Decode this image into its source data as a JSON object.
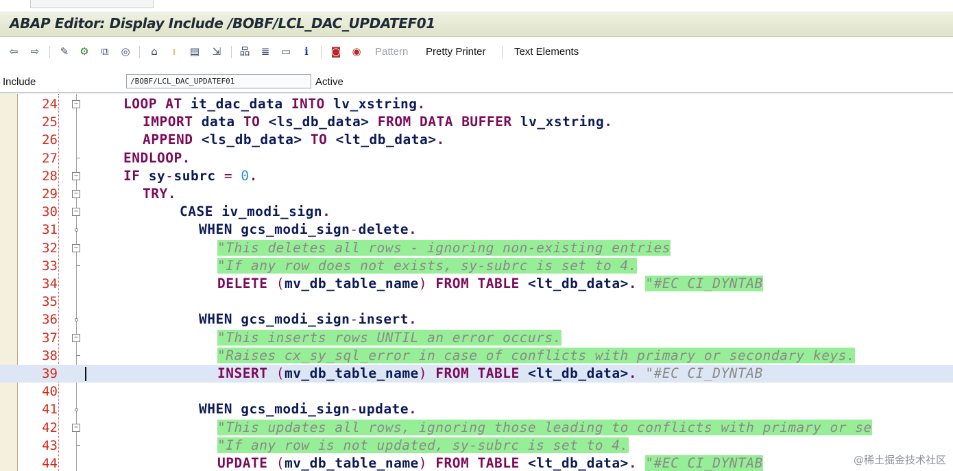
{
  "window": {
    "title": "ABAP Editor: Display Include /BOBF/LCL_DAC_UPDATEF01"
  },
  "toolbar": {
    "icons": [
      "back-arrow-icon",
      "forward-arrow-icon",
      "other-object-icon",
      "display-change-icon",
      "activate-icon",
      "where-used-icon",
      "object-list-icon",
      "navigation-window-icon",
      "set-breakpoint-icon",
      "insert-statement-icon",
      "object-hierarchy-icon",
      "display-structure-icon",
      "fullscreen-icon",
      "info-icon",
      "enhance-icon",
      "debug-icon"
    ],
    "pattern_label": "Pattern",
    "pretty_printer_label": "Pretty Printer",
    "text_elements_label": "Text Elements"
  },
  "include_field": {
    "label": "Include",
    "value": "/BOBF/LCL_DAC_UPDATEF01",
    "status": "Active"
  },
  "editor": {
    "line_numbers": [
      "24",
      "25",
      "26",
      "27",
      "28",
      "29",
      "30",
      "31",
      "32",
      "33",
      "34",
      "35",
      "36",
      "37",
      "38",
      "39",
      "40",
      "41",
      "42",
      "43",
      "44"
    ],
    "current_line": "39"
  },
  "code": {
    "l24": [
      "LOOP AT",
      "it_dac_data",
      "INTO",
      "lv_xstring",
      "."
    ],
    "l25": [
      "IMPORT",
      "data",
      "TO",
      "<ls_db_data>",
      "FROM DATA BUFFER",
      "lv_xstring",
      "."
    ],
    "l26": [
      "APPEND",
      "<ls_db_data>",
      "TO",
      "<lt_db_data>",
      "."
    ],
    "l27": [
      "ENDLOOP."
    ],
    "l28": [
      "IF",
      "sy",
      "-",
      "subrc",
      "=",
      "0",
      "."
    ],
    "l29": [
      "TRY."
    ],
    "l30": [
      "CASE",
      "iv_modi_sign",
      "."
    ],
    "l31": [
      "WHEN",
      "gcs_modi_sign",
      "-",
      "delete",
      "."
    ],
    "l32": "\"This deletes all rows - ignoring non-existing entries",
    "l33": "\"If any row does not exists, sy-subrc is set to 4.",
    "l34": [
      "DELETE",
      "(",
      "mv_db_table_name",
      ")",
      "FROM TABLE",
      "<lt_db_data>",
      ".",
      "\"#EC CI_DYNTAB"
    ],
    "l36": [
      "WHEN",
      "gcs_modi_sign",
      "-",
      "insert",
      "."
    ],
    "l37": "\"This inserts rows UNTIL an error occurs.",
    "l38": "\"Raises cx_sy_sql_error in case of conflicts with primary or secondary keys.",
    "l39": [
      "INSERT",
      "(",
      "mv_db_table_name",
      ")",
      "FROM TABLE",
      "<lt_db_data>",
      ".",
      "\"#EC CI_DYNTAB"
    ],
    "l41": [
      "WHEN",
      "gcs_modi_sign",
      "-",
      "update",
      "."
    ],
    "l42": "\"This updates all rows, ignoring those leading to conflicts with primary or se",
    "l43": "\"If any row is not updated, sy-subrc is set to 4.",
    "l44": [
      "UPDATE",
      "(",
      "mv_db_table_name",
      ")",
      "FROM TABLE",
      "<lt_db_data>",
      ".",
      "\"#EC CI_DYNTAB"
    ]
  },
  "watermark": "@稀土掘金技术社区",
  "colors": {
    "keyword": "#7c0a5b",
    "identifier": "#0c1a55",
    "number": "#2a8fd8",
    "comment_text": "#8a8a8a",
    "comment_highlight": "#96ee96",
    "line_number": "#d5281a",
    "current_line": "#dde6f4",
    "title_bar": "#e6e9d2"
  }
}
